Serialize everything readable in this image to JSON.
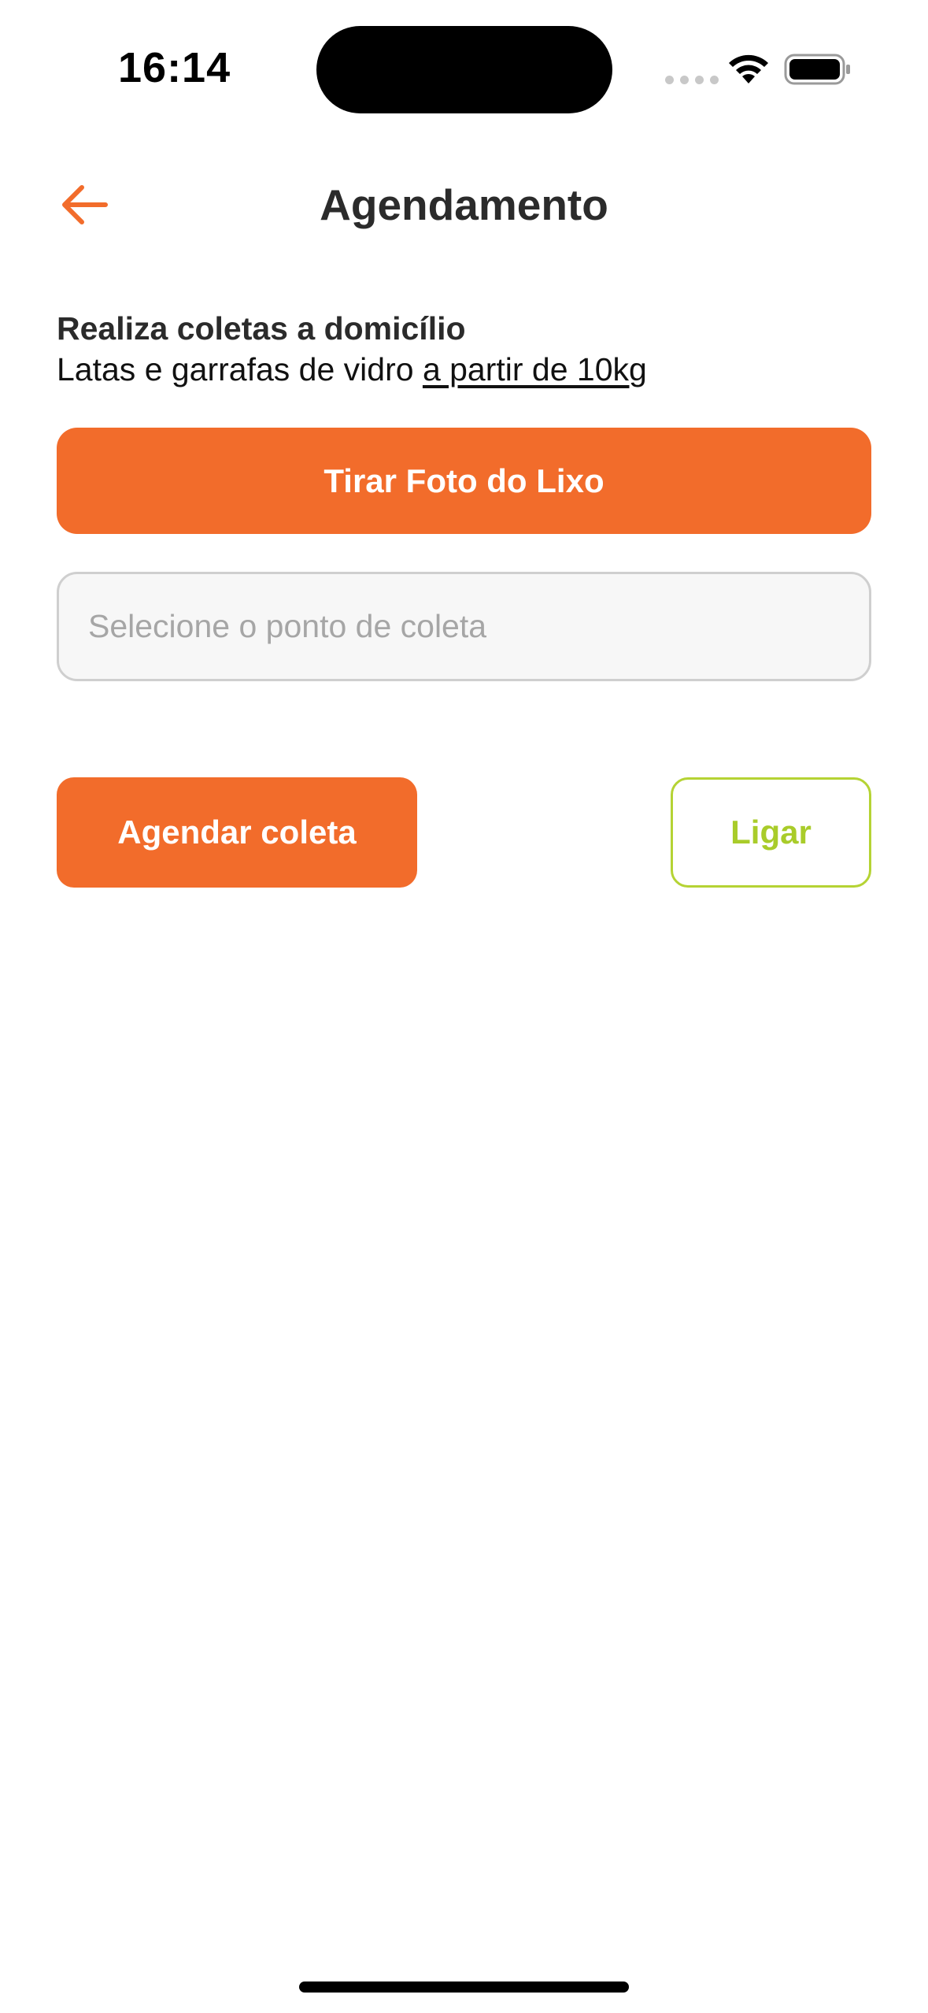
{
  "status_bar": {
    "time": "16:14"
  },
  "header": {
    "title": "Agendamento",
    "back_icon": "arrow-left-icon"
  },
  "info": {
    "title": "Realiza coletas a domicílio",
    "line_prefix": "Latas e garrafas de vidro ",
    "line_highlight": "a partir de 10kg"
  },
  "actions": {
    "photo_label": "Tirar Foto do Lixo",
    "select_placeholder": "Selecione o ponto de coleta",
    "schedule_label": "Agendar coleta",
    "call_label": "Ligar"
  },
  "colors": {
    "primary": "#f26c2b",
    "secondary": "#a9cc2a",
    "text": "#2b2b2b",
    "placeholder": "#a6a6a6"
  }
}
